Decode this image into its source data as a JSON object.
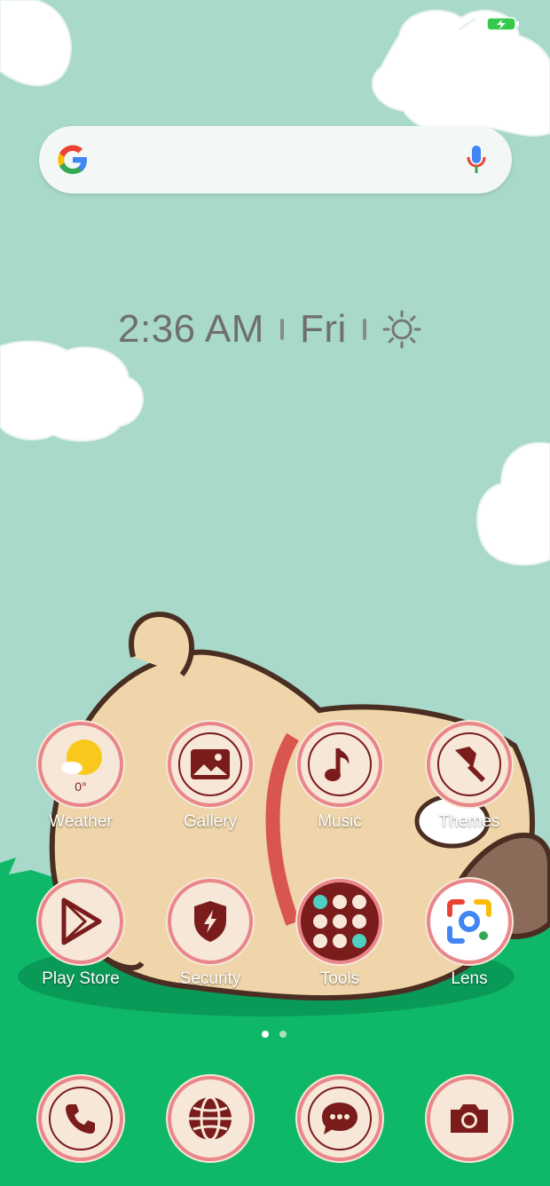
{
  "status": {
    "battery_icon": "battery-charging-icon",
    "signal_icon": "signal-icon"
  },
  "search": {
    "logo": "google-g-icon",
    "mic": "mic-icon"
  },
  "clock": {
    "time": "2:36 AM",
    "day": "Fri",
    "weather_icon": "sun-icon"
  },
  "apps": [
    {
      "label": "Weather",
      "icon": "weather-icon",
      "temp": "0°"
    },
    {
      "label": "Gallery",
      "icon": "gallery-icon"
    },
    {
      "label": "Music",
      "icon": "music-icon"
    },
    {
      "label": "Themes",
      "icon": "brush-icon"
    },
    {
      "label": "Play Store",
      "icon": "play-store-icon"
    },
    {
      "label": "Security",
      "icon": "shield-icon"
    },
    {
      "label": "Tools",
      "icon": "folder-icon"
    },
    {
      "label": "Lens",
      "icon": "lens-icon"
    }
  ],
  "dock": [
    {
      "icon": "phone-icon"
    },
    {
      "icon": "browser-globe-icon"
    },
    {
      "icon": "messages-icon"
    },
    {
      "icon": "camera-icon"
    }
  ],
  "pager": {
    "pages": 2,
    "current": 1
  }
}
